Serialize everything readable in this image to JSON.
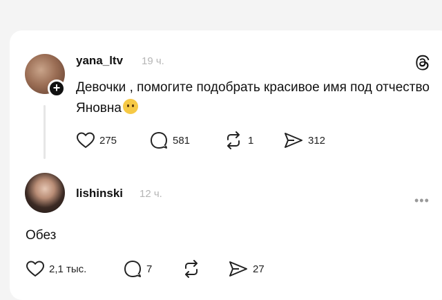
{
  "post": {
    "username": "yana_ltv",
    "time": "19 ч.",
    "text": "Девочки , помогите подобрать красивое имя под отчество Яновна",
    "likes": "275",
    "comments": "581",
    "reposts": "1",
    "shares": "312"
  },
  "reply": {
    "username": "lishinski",
    "time": "12 ч.",
    "text": "Обез",
    "likes": "2,1 тыс.",
    "comments": "7",
    "reposts": "",
    "shares": "27"
  },
  "icons": {
    "app_logo": "threads-logo-icon",
    "follow": "plus-icon",
    "like": "heart-icon",
    "comment": "comment-icon",
    "repost": "repost-icon",
    "share": "share-icon",
    "more": "more-icon",
    "emoji": "crying-smile-emoji"
  },
  "colors": {
    "background": "#f4f4f4",
    "card": "#ffffff",
    "text": "#111111",
    "muted": "#b5b5b5"
  }
}
